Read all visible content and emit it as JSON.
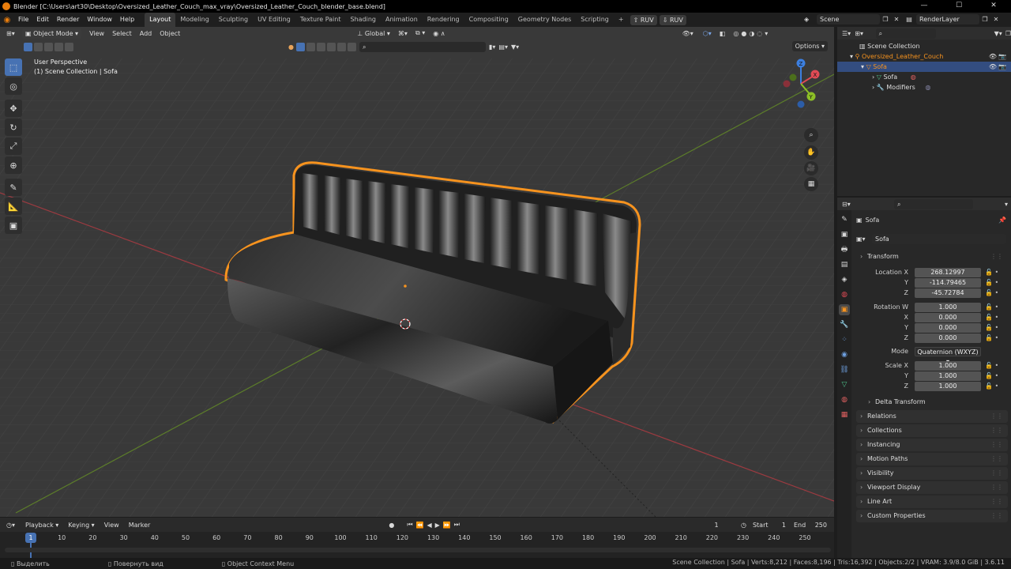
{
  "window": {
    "title": "Blender [C:\\Users\\art30\\Desktop\\Oversized_Leather_Couch_max_vray\\Oversized_Leather_Couch_blender_base.blend]",
    "min": "—",
    "max": "☐",
    "close": "✕"
  },
  "topbar": {
    "menus": [
      "File",
      "Edit",
      "Render",
      "Window",
      "Help"
    ],
    "workspaces": [
      "Layout",
      "Modeling",
      "Sculpting",
      "UV Editing",
      "Texture Paint",
      "Shading",
      "Animation",
      "Rendering",
      "Compositing",
      "Geometry Nodes",
      "Scripting"
    ],
    "active_workspace": "Layout",
    "add_tab": "+",
    "ruv1": "RUV",
    "ruv2": "RUV",
    "scene": "Scene",
    "view_layer": "RenderLayer"
  },
  "viewport": {
    "mode": "Object Mode",
    "menus": [
      "View",
      "Select",
      "Add",
      "Object"
    ],
    "orientation": "Global",
    "info_line1": "User Perspective",
    "info_line2": "(1) Scene Collection | Sofa",
    "options": "Options"
  },
  "timeline": {
    "menus": [
      "Playback",
      "Keying",
      "View",
      "Marker"
    ],
    "current_frame": "1",
    "start_label": "Start",
    "start": "1",
    "end_label": "End",
    "end": "250",
    "ruler": [
      "10",
      "20",
      "30",
      "40",
      "50",
      "60",
      "70",
      "80",
      "90",
      "100",
      "110",
      "120",
      "130",
      "140",
      "150",
      "160",
      "170",
      "180",
      "190",
      "200",
      "210",
      "220",
      "230",
      "240",
      "250"
    ]
  },
  "statusbar": {
    "hint1": "Выделить",
    "hint2": "Повернуть вид",
    "hint3": "Object Context Menu",
    "stats": "Scene Collection | Sofa | Verts:8,212 | Faces:8,196 | Tris:16,392 | Objects:2/2 | VRAM: 3.9/8.0 GiB | 3.6.11"
  },
  "outliner": {
    "rows": [
      {
        "label": "Scene Collection"
      },
      {
        "label": "Oversized_Leather_Couch"
      },
      {
        "label": "Sofa"
      },
      {
        "label": "Sofa"
      },
      {
        "label": "Modifiers"
      }
    ]
  },
  "properties": {
    "object_name": "Sofa",
    "datablock_name": "Sofa",
    "transform_label": "Transform",
    "location_label": "Location X",
    "y_label": "Y",
    "z_label": "Z",
    "x_label": "X",
    "w_label": "Rotation W",
    "mode_label": "Mode",
    "scale_label": "Scale X",
    "location": [
      "268.12997",
      "-114.79465",
      "-45.72784"
    ],
    "rotation": [
      "1.000",
      "0.000",
      "0.000",
      "0.000"
    ],
    "mode": "Quaternion (WXYZ)",
    "scale": [
      "1.000",
      "1.000",
      "1.000"
    ],
    "delta_transform": "Delta Transform",
    "panels": [
      "Relations",
      "Collections",
      "Instancing",
      "Motion Paths",
      "Visibility",
      "Viewport Display",
      "Line Art",
      "Custom Properties"
    ]
  },
  "colors": {
    "accent": "#4772b3",
    "selection_outline": "#f7931e",
    "x_axis": "#e04b55",
    "y_axis": "#8cbf26",
    "z_axis": "#3c7fe0"
  }
}
